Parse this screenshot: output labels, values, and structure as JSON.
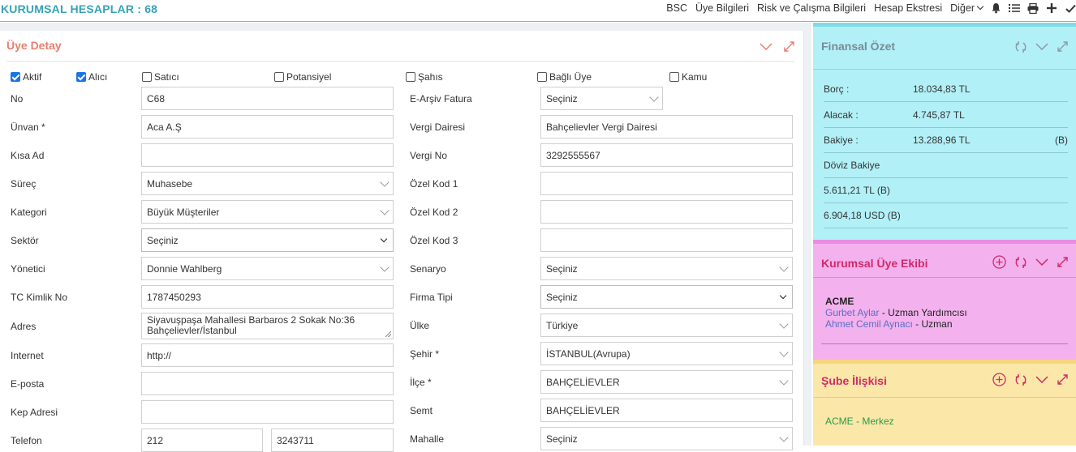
{
  "header": {
    "title": "KURUMSAL HESAPLAR : 68",
    "nav": [
      "BSC",
      "Üye Bilgileri",
      "Risk ve Çalışma Bilgileri",
      "Hesap Ekstresi",
      "Diğer"
    ],
    "icons": [
      "bell-icon",
      "list-icon",
      "print-icon",
      "plus-icon",
      "check-icon"
    ]
  },
  "detail": {
    "title": "Üye Detay",
    "checkboxes": [
      {
        "label": "Aktif",
        "checked": true
      },
      {
        "label": "Alıcı",
        "checked": true
      },
      {
        "label": "Satıcı",
        "checked": false
      },
      {
        "label": "Potansiyel",
        "checked": false
      },
      {
        "label": "Şahıs",
        "checked": false
      },
      {
        "label": "Bağlı Üye",
        "checked": false
      },
      {
        "label": "Kamu",
        "checked": false
      }
    ],
    "left": {
      "no": {
        "label": "No",
        "value": "C68"
      },
      "unvan": {
        "label": "Ünvan *",
        "value": "Aca A.Ş"
      },
      "kisa_ad": {
        "label": "Kısa Ad",
        "value": ""
      },
      "surec": {
        "label": "Süreç",
        "value": "Muhasebe"
      },
      "kategori": {
        "label": "Kategori",
        "value": "Büyük Müşteriler"
      },
      "sektor": {
        "label": "Sektör",
        "value": "Seçiniz"
      },
      "yonetici": {
        "label": "Yönetici",
        "value": "Donnie Wahlberg"
      },
      "tc": {
        "label": "TC Kimlik No",
        "value": "1787450293"
      },
      "adres": {
        "label": "Adres",
        "value": "Siyavuşpaşa Mahallesi Barbaros 2 Sokak No:36 Bahçelievler/İstanbul"
      },
      "internet": {
        "label": "Internet",
        "value": "http://"
      },
      "eposta": {
        "label": "E-posta",
        "value": ""
      },
      "kep": {
        "label": "Kep Adresi",
        "value": ""
      },
      "telefon": {
        "label": "Telefon",
        "area": "212",
        "number": "3243711"
      }
    },
    "right": {
      "earsiv": {
        "label": "E-Arşiv Fatura",
        "value": "Seçiniz"
      },
      "vergi_dairesi": {
        "label": "Vergi Dairesi",
        "value": "Bahçelievler Vergi Dairesi"
      },
      "vergi_no": {
        "label": "Vergi No",
        "value": "3292555567"
      },
      "ozel1": {
        "label": "Özel Kod 1",
        "value": ""
      },
      "ozel2": {
        "label": "Özel Kod 2",
        "value": ""
      },
      "ozel3": {
        "label": "Özel Kod 3",
        "value": ""
      },
      "senaryo": {
        "label": "Senaryo",
        "value": "Seçiniz"
      },
      "firma_tipi": {
        "label": "Firma Tipi",
        "value": "Seçiniz"
      },
      "ulke": {
        "label": "Ülke",
        "value": "Türkiye"
      },
      "sehir": {
        "label": "Şehir *",
        "value": "İSTANBUL(Avrupa)"
      },
      "ilce": {
        "label": "İlçe *",
        "value": "BAHÇELİEVLER"
      },
      "semt": {
        "label": "Semt",
        "value": "BAHÇELİEVLER"
      },
      "mahalle": {
        "label": "Mahalle",
        "value": "Seçiniz"
      }
    }
  },
  "finance": {
    "title": "Finansal Özet",
    "borc": {
      "label": "Borç :",
      "value": "18.034,83 TL"
    },
    "alacak": {
      "label": "Alacak :",
      "value": "4.745,87 TL"
    },
    "bakiye": {
      "label": "Bakiye :",
      "value": "13.288,96 TL",
      "suffix": "(B)"
    },
    "doviz_label": "Döviz Bakiye",
    "doviz": [
      "5.611,21 TL (B)",
      "6.904,18 USD (B)"
    ]
  },
  "team": {
    "title": "Kurumsal Üye Ekibi",
    "company": "ACME",
    "members": [
      {
        "name": "Gurbet Aylar",
        "role": " - Uzman Yardımcısı"
      },
      {
        "name": "Ahmet Cemil Aynacı",
        "role": " - Uzman"
      }
    ]
  },
  "branch": {
    "title": "Şube İlişkisi",
    "item": "ACME - Merkez"
  },
  "colors": {
    "accent": "#36a3b6",
    "detail_title": "#e87e6e",
    "finance_bg": "#b2f0f7",
    "team_bg": "#f3b1ee",
    "branch_bg": "#fbe7a8",
    "checkbox": "#1a73e8"
  }
}
